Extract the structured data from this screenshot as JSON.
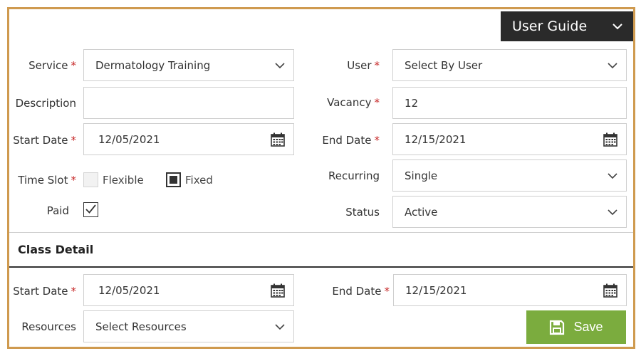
{
  "header": {
    "user_guide_label": "User Guide"
  },
  "form": {
    "service": {
      "label": "Service",
      "value": "Dermatology Training"
    },
    "user": {
      "label": "User",
      "value": "Select By User"
    },
    "description": {
      "label": "Description",
      "value": ""
    },
    "vacancy": {
      "label": "Vacancy",
      "value": "12"
    },
    "start_date": {
      "label": "Start Date",
      "value": "12/05/2021"
    },
    "end_date": {
      "label": "End Date",
      "value": "12/15/2021"
    },
    "time_slot": {
      "label": "Time Slot",
      "option_flexible": "Flexible",
      "option_fixed": "Fixed",
      "fixed_selected": true
    },
    "recurring": {
      "label": "Recurring",
      "value": "Single"
    },
    "paid": {
      "label": "Paid",
      "checked": true
    },
    "status": {
      "label": "Status",
      "value": "Active"
    },
    "required_marker": "*"
  },
  "class_detail": {
    "title": "Class Detail",
    "start_date": {
      "label": "Start Date",
      "value": "12/05/2021"
    },
    "end_date": {
      "label": "End Date",
      "value": "12/15/2021"
    },
    "resources": {
      "label": "Resources",
      "placeholder": "Select Resources"
    }
  },
  "actions": {
    "save_label": "Save"
  },
  "colors": {
    "accent_border": "#cf9a4f",
    "save_button": "#7bac3e",
    "required": "#c62828",
    "guide_bg": "#2a2a2a"
  }
}
